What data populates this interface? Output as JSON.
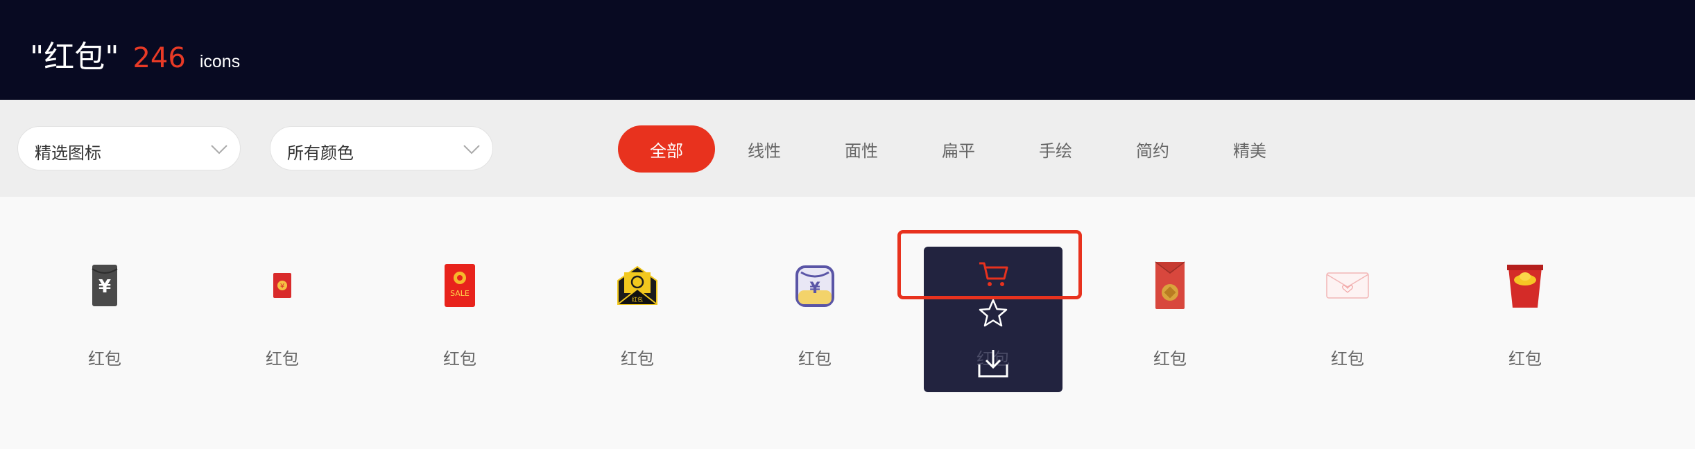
{
  "header": {
    "query": "\"红包\"",
    "count": "246",
    "unit": "icons"
  },
  "filters": {
    "selects": [
      {
        "value": "精选图标",
        "icon": "chevron-down-icon"
      },
      {
        "value": "所有颜色",
        "icon": "chevron-down-icon"
      }
    ],
    "styles": [
      "全部",
      "线性",
      "面性",
      "扁平",
      "手绘",
      "简约",
      "精美"
    ],
    "active_style": "全部"
  },
  "icons": [
    {
      "name": "红包",
      "icon": "black-envelope-yen-icon"
    },
    {
      "name": "红包",
      "icon": "small-red-envelope-yen-icon"
    },
    {
      "name": "红包",
      "icon": "red-envelope-sale-icon"
    },
    {
      "name": "红包",
      "icon": "black-gold-envelope-icon"
    },
    {
      "name": "红包",
      "icon": "jar-yen-icon"
    },
    {
      "name": "红包",
      "icon": "hovered-icon"
    },
    {
      "name": "红包",
      "icon": "red-envelope-coin-icon"
    },
    {
      "name": "红包",
      "icon": "pink-heart-envelope-icon"
    },
    {
      "name": "红包",
      "icon": "red-envelope-gold-ingot-icon"
    }
  ],
  "hover_overlay": {
    "actions": [
      "cart-icon",
      "star-icon",
      "download-icon"
    ]
  },
  "colors": {
    "header_bg": "#080a22",
    "accent": "#e8321e",
    "overlay_bg": "#22233f"
  }
}
